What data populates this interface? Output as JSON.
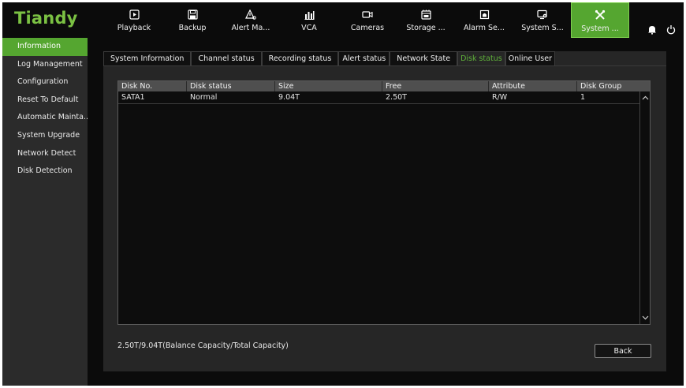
{
  "brand": "Tiandy",
  "nav": [
    {
      "label": "Playback",
      "icon": "playback-icon"
    },
    {
      "label": "Backup",
      "icon": "save-icon"
    },
    {
      "label": "Alert Ma...",
      "icon": "alert-icon"
    },
    {
      "label": "VCA",
      "icon": "analytics-icon"
    },
    {
      "label": "Cameras",
      "icon": "camera-icon"
    },
    {
      "label": "Storage ...",
      "icon": "storage-icon"
    },
    {
      "label": "Alarm Se...",
      "icon": "alarm-icon"
    },
    {
      "label": "System S...",
      "icon": "monitor-settings-icon"
    },
    {
      "label": "System ...",
      "icon": "tools-icon",
      "active": true
    }
  ],
  "topright": {
    "bell_icon": "bell-icon",
    "power_icon": "power-icon"
  },
  "sidebar": {
    "items": [
      {
        "label": "Information",
        "active": true
      },
      {
        "label": "Log Management"
      },
      {
        "label": "Configuration"
      },
      {
        "label": "Reset To Default"
      },
      {
        "label": "Automatic Mainta..."
      },
      {
        "label": "System Upgrade"
      },
      {
        "label": "Network Detect"
      },
      {
        "label": "Disk Detection"
      }
    ]
  },
  "tabs": [
    {
      "label": "System Information"
    },
    {
      "label": "Channel status"
    },
    {
      "label": "Recording status"
    },
    {
      "label": "Alert status"
    },
    {
      "label": "Network State"
    },
    {
      "label": "Disk status",
      "active": true
    },
    {
      "label": "Online User"
    }
  ],
  "table": {
    "columns": [
      "Disk No.",
      "Disk status",
      "Size",
      "Free",
      "Attribute",
      "Disk Group"
    ],
    "rows": [
      [
        "SATA1",
        "Normal",
        "9.04T",
        "2.50T",
        "R/W",
        "1"
      ]
    ]
  },
  "capacity_text": "2.50T/9.04T(Balance Capacity/Total Capacity)",
  "back_label": "Back",
  "colors": {
    "accent": "#55a630",
    "logo": "#7bc143",
    "background": "#0b0b0b",
    "panel": "#262626",
    "sidebar": "#2b2b2b"
  }
}
